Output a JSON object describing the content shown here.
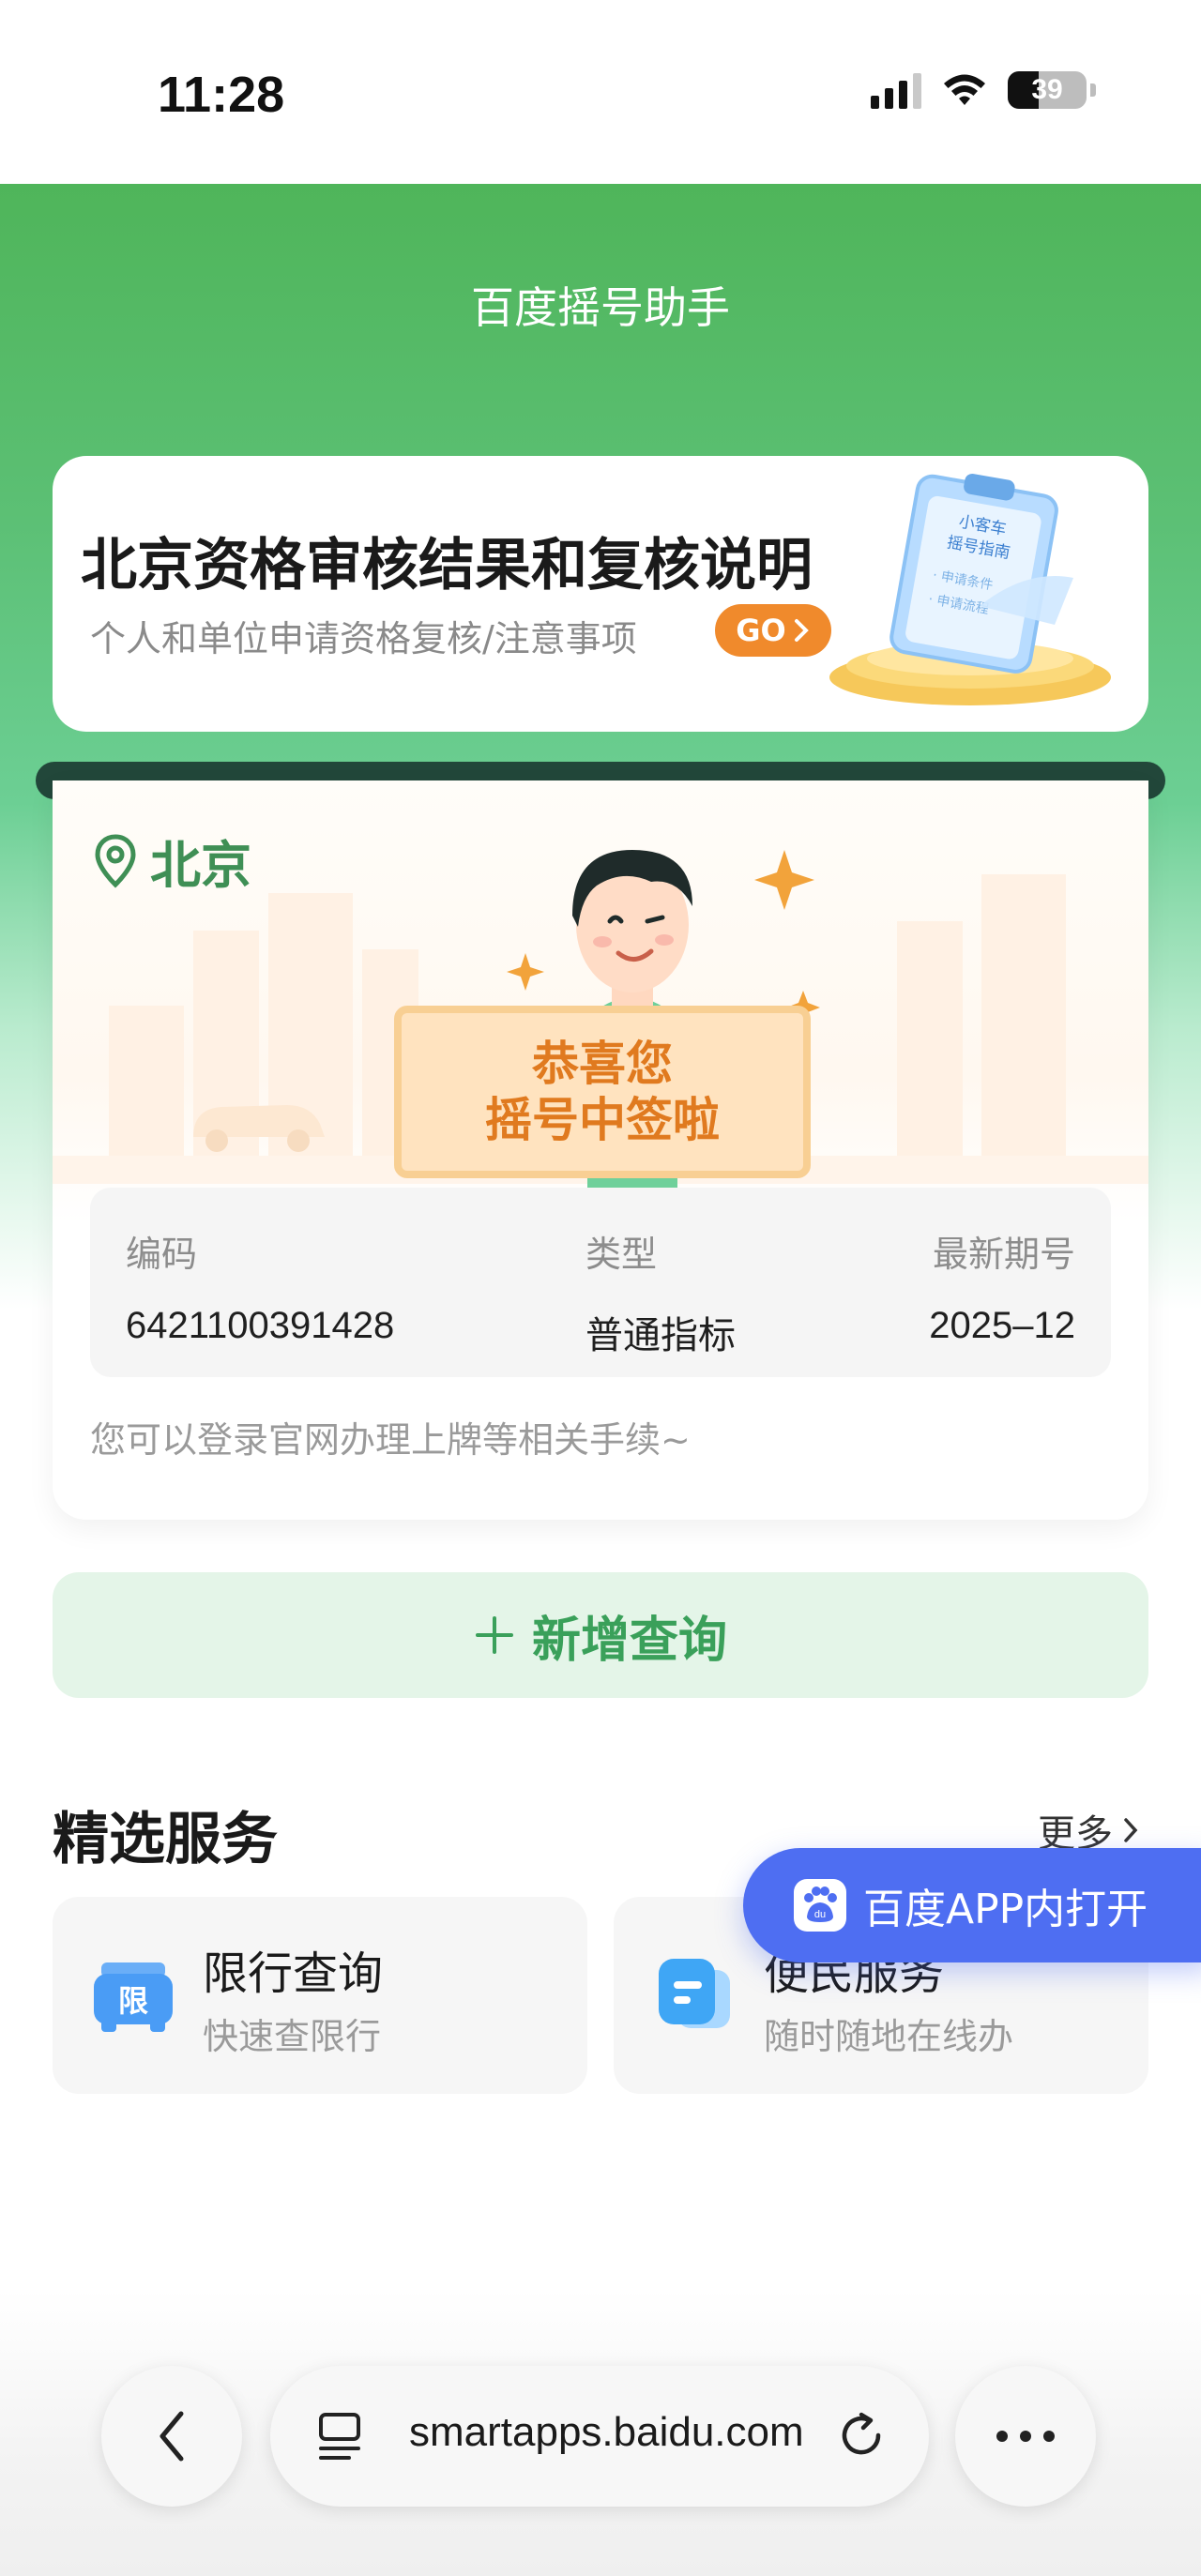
{
  "status_bar": {
    "time": "11:28",
    "battery": "39",
    "battery_level": 0.39
  },
  "header": {
    "title": "百度摇号助手"
  },
  "banner": {
    "title": "北京资格审核结果和复核说明",
    "subtitle": "个人和单位申请资格复核/注意事项",
    "go_label": "GO",
    "art_lines": [
      "小客车",
      "摇号指南",
      "· 申请条件",
      "· 申请流程"
    ]
  },
  "result": {
    "city": "北京",
    "sign_line1": "恭喜您",
    "sign_line2": "摇号中签啦",
    "fields": [
      {
        "label": "编码",
        "value": "6421100391428"
      },
      {
        "label": "类型",
        "value": "普通指标"
      },
      {
        "label": "最新期号",
        "value": "2025–12"
      }
    ],
    "tip": "您可以登录官网办理上牌等相关手续~"
  },
  "add_query": {
    "label": "新增查询"
  },
  "services": {
    "title": "精选服务",
    "more_label": "更多",
    "items": [
      {
        "title": "限行查询",
        "subtitle": "快速查限行",
        "icon_glyph": "限"
      },
      {
        "title": "便民服务",
        "subtitle": "随时随地在线办"
      }
    ]
  },
  "open_app": {
    "label": "百度APP内打开",
    "icon_glyph": "du"
  },
  "browser": {
    "url": "smartapps.baidu.com"
  },
  "colors": {
    "brand_green": "#4fb55a",
    "accent_orange": "#f08a2c",
    "app_blue": "#4e6ef2"
  }
}
